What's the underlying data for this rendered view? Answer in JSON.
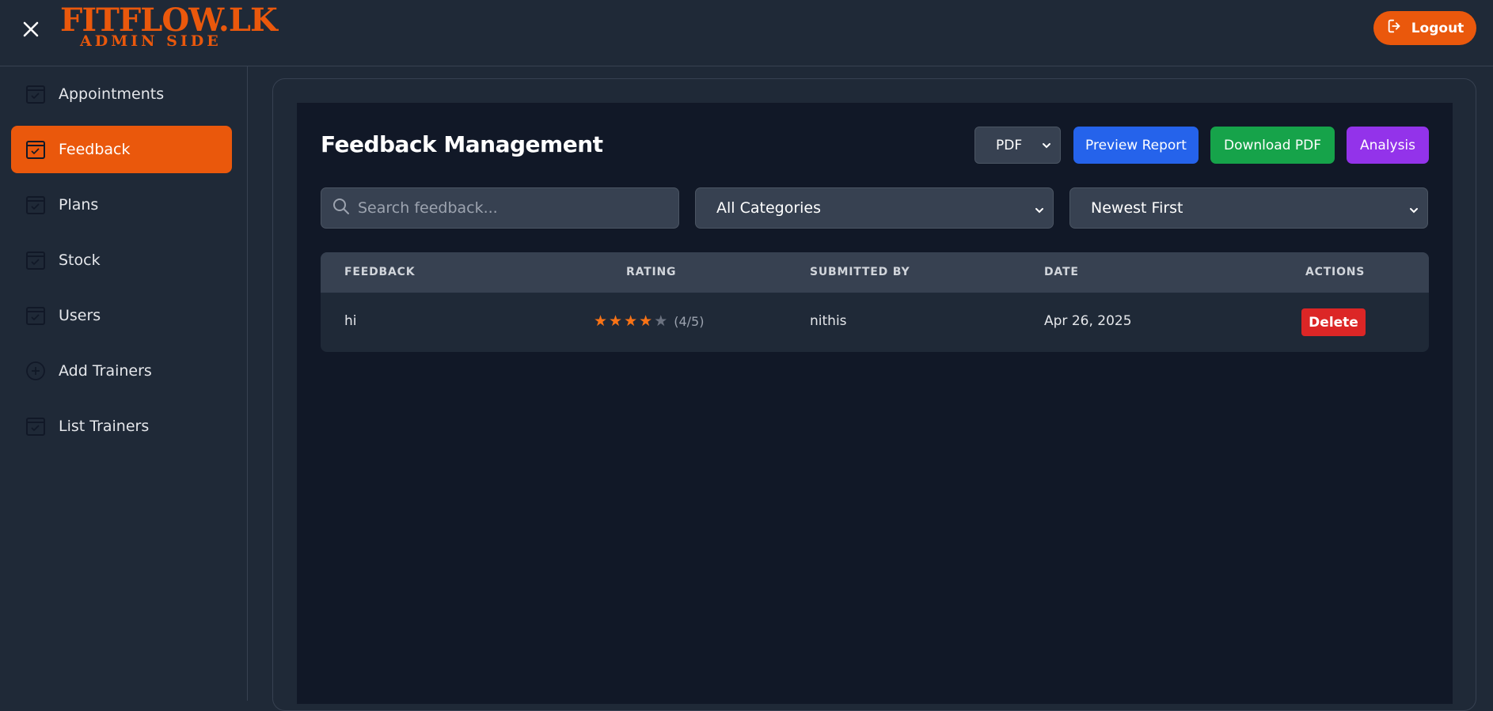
{
  "brand": {
    "title": "FITFLOW.LK",
    "subtitle": "ADMIN SIDE",
    "accent_color": "#ea580c"
  },
  "header": {
    "close_icon": "close-icon",
    "logout_label": "Logout",
    "logout_icon": "logout-icon"
  },
  "sidebar": {
    "items": [
      {
        "label": "Appointments",
        "icon": "calendar-check-icon",
        "active": false
      },
      {
        "label": "Feedback",
        "icon": "calendar-check-icon",
        "active": true
      },
      {
        "label": "Plans",
        "icon": "calendar-check-icon",
        "active": false
      },
      {
        "label": "Stock",
        "icon": "calendar-check-icon",
        "active": false
      },
      {
        "label": "Users",
        "icon": "calendar-check-icon",
        "active": false
      },
      {
        "label": "Add Trainers",
        "icon": "plus-circle-icon",
        "active": false
      },
      {
        "label": "List Trainers",
        "icon": "calendar-check-icon",
        "active": false
      }
    ]
  },
  "main": {
    "title": "Feedback Management",
    "export_format": "PDF",
    "buttons": {
      "preview": "Preview Report",
      "download": "Download PDF",
      "analysis": "Analysis"
    },
    "button_colors": {
      "preview": "#2563eb",
      "download": "#16a34a",
      "analysis": "#9333ea",
      "delete": "#dc2626"
    },
    "search": {
      "placeholder": "Search feedback...",
      "value": ""
    },
    "category_filter": "All Categories",
    "sort_filter": "Newest First"
  },
  "table": {
    "headers": [
      "FEEDBACK",
      "RATING",
      "SUBMITTED BY",
      "DATE",
      "ACTIONS"
    ],
    "rows": [
      {
        "feedback": "hi",
        "rating": 4,
        "rating_max": 5,
        "rating_text": "(4/5)",
        "submitted_by": "nithis",
        "date": "Apr 26, 2025",
        "action": "Delete"
      }
    ]
  }
}
